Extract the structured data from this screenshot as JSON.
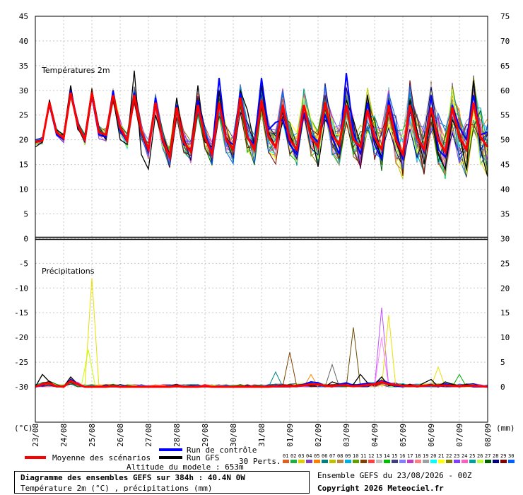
{
  "chart_data": {
    "type": "line",
    "title_temp": "Températures 2m",
    "title_precip": "Précipitations",
    "left_unit": "(°C)",
    "right_unit": "(mm)",
    "dates": [
      "23/08",
      "24/08",
      "25/08",
      "26/08",
      "27/08",
      "28/08",
      "29/08",
      "30/08",
      "31/08",
      "01/09",
      "02/09",
      "03/09",
      "04/09",
      "05/09",
      "06/09",
      "07/09",
      "08/09"
    ],
    "left_ticks": [
      45,
      40,
      35,
      30,
      25,
      20,
      15,
      10,
      5,
      0,
      -5,
      -10,
      -15,
      -20,
      -25,
      -30
    ],
    "right_ticks": [
      75,
      70,
      65,
      60,
      55,
      50,
      45,
      40,
      35,
      30,
      25,
      20,
      15,
      10,
      5,
      0
    ],
    "temp_ylim": [
      0,
      45
    ],
    "precip_ylim": [
      0,
      30
    ],
    "temp_times": [
      0,
      6,
      12,
      18,
      24,
      30,
      36,
      42,
      48,
      54,
      60,
      66,
      72,
      78,
      84,
      90,
      96,
      102,
      108,
      114,
      120,
      126,
      132,
      138,
      144,
      150,
      156,
      162,
      168,
      174,
      180,
      186,
      192,
      198,
      204,
      210,
      216,
      222,
      228,
      234,
      240,
      246,
      252,
      258,
      264,
      270,
      276,
      282,
      288,
      294,
      300,
      306,
      312,
      318,
      324,
      330,
      336,
      342,
      348,
      354,
      360,
      366,
      372,
      378,
      384
    ],
    "temp_mean": [
      19.5,
      19.8,
      27.5,
      21.5,
      20.3,
      29.5,
      23.0,
      20.0,
      29.5,
      21.5,
      21.0,
      29.0,
      22.5,
      19.8,
      29.0,
      21.8,
      18.0,
      27.5,
      20.0,
      16.5,
      26.5,
      19.5,
      17.5,
      27.0,
      20.5,
      17.0,
      27.5,
      20.0,
      18.0,
      28.5,
      20.5,
      18.0,
      28.0,
      20.5,
      18.5,
      27.0,
      20.0,
      18.0,
      27.0,
      20.5,
      18.5,
      27.5,
      21.0,
      19.0,
      27.0,
      20.0,
      18.5,
      26.0,
      20.5,
      18.0,
      27.0,
      20.0,
      17.0,
      27.0,
      20.5,
      18.0,
      26.5,
      20.0,
      17.5,
      26.5,
      20.5,
      18.0,
      27.5,
      20.5,
      18.5
    ],
    "temp_control": [
      19.5,
      20.0,
      27.0,
      21.0,
      20.0,
      30.0,
      23.5,
      19.5,
      29.0,
      21.0,
      20.5,
      30.0,
      22.0,
      19.5,
      29.5,
      22.0,
      17.5,
      28.5,
      19.5,
      16.5,
      27.0,
      19.0,
      18.0,
      28.0,
      21.0,
      17.5,
      32.5,
      20.0,
      19.0,
      29.5,
      20.5,
      19.0,
      32.5,
      22.0,
      23.5,
      24.0,
      19.0,
      17.0,
      25.5,
      21.0,
      19.5,
      25.0,
      20.5,
      17.0,
      33.5,
      21.5,
      17.0,
      27.5,
      19.0,
      16.0,
      28.0,
      22.0,
      16.0,
      26.0,
      21.0,
      17.5,
      29.0,
      18.0,
      16.5,
      27.0,
      22.5,
      20.0,
      29.0,
      21.0,
      21.5
    ],
    "temp_gfs": [
      18.5,
      19.5,
      28.0,
      22.0,
      21.0,
      31.0,
      22.5,
      19.5,
      29.0,
      22.0,
      20.0,
      28.5,
      20.0,
      19.0,
      34.0,
      17.0,
      14.0,
      25.0,
      20.0,
      17.0,
      28.5,
      20.0,
      17.5,
      31.0,
      19.5,
      18.5,
      30.0,
      20.5,
      18.0,
      30.0,
      26.0,
      19.0,
      31.0,
      21.5,
      18.5,
      23.5,
      21.0,
      17.5,
      27.0,
      21.5,
      14.5,
      24.0,
      22.0,
      18.5,
      28.0,
      24.0,
      19.0,
      29.0,
      20.0,
      16.5,
      26.0,
      19.5,
      16.0,
      28.0,
      22.0,
      15.0,
      25.5,
      17.0,
      14.0,
      24.0,
      21.0,
      14.0,
      32.0,
      18.0,
      12.5
    ],
    "precip_times": [
      0,
      6,
      12,
      18,
      24,
      30,
      36,
      42,
      48,
      54,
      60,
      66,
      72,
      78,
      84,
      90,
      96,
      102,
      108,
      114,
      120,
      126,
      132,
      138,
      144,
      150,
      156,
      162,
      168,
      174,
      180,
      186,
      192,
      198,
      204,
      210,
      216,
      222,
      228,
      234,
      240,
      246,
      252,
      258,
      264,
      270,
      276,
      282,
      288,
      294,
      300,
      306,
      312,
      318,
      324,
      330,
      336,
      342,
      348,
      354,
      360,
      366,
      372,
      378,
      384
    ],
    "precip_mean": [
      0.0,
      0.5,
      0.7,
      0.1,
      0.0,
      1.2,
      0.5,
      0.0,
      0.0,
      0.0,
      0.0,
      0.1,
      0.0,
      0.0,
      0.0,
      0.0,
      0.0,
      0.0,
      0.0,
      0.0,
      0.1,
      0.0,
      0.0,
      0.0,
      0.1,
      0.0,
      0.0,
      0.0,
      0.0,
      0.0,
      0.0,
      0.0,
      0.0,
      0.0,
      0.1,
      0.1,
      0.1,
      0.2,
      0.3,
      0.5,
      0.5,
      0.2,
      0.1,
      0.3,
      0.3,
      0.1,
      0.2,
      0.4,
      0.5,
      1.0,
      0.5,
      0.4,
      0.2,
      0.2,
      0.1,
      0.2,
      0.3,
      0.2,
      0.3,
      0.2,
      0.1,
      0.2,
      0.2,
      0.1,
      0.0
    ],
    "precip_control": [
      0.0,
      0.3,
      0.8,
      0.0,
      0.0,
      1.5,
      0.6,
      0.0,
      0.0,
      0.0,
      0.0,
      0.0,
      0.0,
      0.0,
      0.0,
      0.0,
      0.0,
      0.0,
      0.0,
      0.0,
      0.0,
      0.0,
      0.0,
      0.0,
      0.0,
      0.0,
      0.0,
      0.0,
      0.0,
      0.0,
      0.0,
      0.0,
      0.0,
      0.0,
      0.0,
      0.0,
      0.0,
      0.3,
      0.5,
      1.0,
      0.8,
      0.2,
      0.0,
      0.5,
      0.8,
      0.3,
      0.5,
      0.7,
      0.5,
      1.2,
      0.8,
      0.2,
      0.0,
      0.3,
      0.0,
      0.2,
      0.5,
      0.0,
      0.6,
      0.3,
      0.0,
      0.3,
      0.0,
      0.0,
      0.0
    ],
    "precip_gfs": [
      0.0,
      2.5,
      1.0,
      0.0,
      0.0,
      2.0,
      0.5,
      0.0,
      0.0,
      0.0,
      0.0,
      0.0,
      0.0,
      0.0,
      0.0,
      0.0,
      0.0,
      0.0,
      0.0,
      0.0,
      0.0,
      0.0,
      0.0,
      0.0,
      0.0,
      0.0,
      0.0,
      0.0,
      0.0,
      0.0,
      0.0,
      0.0,
      0.0,
      0.0,
      0.0,
      0.0,
      0.0,
      0.0,
      0.5,
      0.2,
      0.8,
      0.0,
      1.0,
      0.5,
      0.2,
      0.5,
      2.5,
      0.8,
      0.5,
      2.0,
      0.2,
      0.5,
      0.0,
      0.5,
      0.0,
      0.8,
      1.5,
      0.0,
      1.0,
      0.5,
      0.2,
      0.5,
      0.0,
      0.0,
      0.0
    ],
    "precip_spikes": [
      {
        "t": 48,
        "v": 22.0,
        "color": "#e8e000"
      },
      {
        "t": 45,
        "v": 7.5,
        "color": "#c8ff00"
      },
      {
        "t": 216,
        "v": 7.0,
        "color": "#804000"
      },
      {
        "t": 270,
        "v": 12.0,
        "color": "#6a4a00"
      },
      {
        "t": 252,
        "v": 4.5,
        "color": "#606060"
      },
      {
        "t": 294,
        "v": 16.0,
        "color": "#c050ff"
      },
      {
        "t": 300,
        "v": 14.5,
        "color": "#e8e000"
      },
      {
        "t": 294,
        "v": 10.0,
        "color": "#ff88ff"
      },
      {
        "t": 204,
        "v": 3.0,
        "color": "#008080"
      },
      {
        "t": 234,
        "v": 2.5,
        "color": "#ff8800"
      },
      {
        "t": 342,
        "v": 4.0,
        "color": "#e8e000"
      },
      {
        "t": 360,
        "v": 2.5,
        "color": "#00aa00"
      }
    ],
    "legend": {
      "mean": "Moyenne des scénarios",
      "control": "Run de contrôle",
      "gfs": "Run GFS",
      "perts": "30 Perts."
    },
    "perturbation_labels": [
      "01",
      "02",
      "03",
      "04",
      "05",
      "06",
      "07",
      "08",
      "09",
      "10",
      "11",
      "12",
      "13",
      "14",
      "15",
      "16",
      "17",
      "18",
      "19",
      "20",
      "21",
      "22",
      "23",
      "24",
      "25",
      "26",
      "27",
      "28",
      "29",
      "30"
    ],
    "perturbation_colors": [
      "#e06020",
      "#20b040",
      "#e0d000",
      "#8040c0",
      "#ff8000",
      "#008080",
      "#c0c000",
      "#c08040",
      "#00b0e0",
      "#60a000",
      "#804000",
      "#ff4040",
      "#c0c0c0",
      "#00c000",
      "#404080",
      "#8080ff",
      "#c040c0",
      "#ff8080",
      "#a0a0a0",
      "#00ffff",
      "#ffff00",
      "#808000",
      "#8040ff",
      "#ff60c0",
      "#00a0a0",
      "#c0ff40",
      "#006000",
      "#000080",
      "#800000",
      "#0060ff"
    ],
    "colors": {
      "mean": "#ff0000",
      "control": "#0000ff",
      "gfs": "#000000"
    }
  },
  "footer": {
    "title": "Diagramme des ensembles GEFS sur 384h : 40.4N 0W",
    "subtitle": "Température 2m (°C) , précipitations (mm)",
    "altitude": "Altitude du modele : 653m",
    "ensemble_run": "Ensemble GEFS du 23/08/2026 - 00Z",
    "copyright": "Copyright 2026 Meteociel.fr"
  }
}
